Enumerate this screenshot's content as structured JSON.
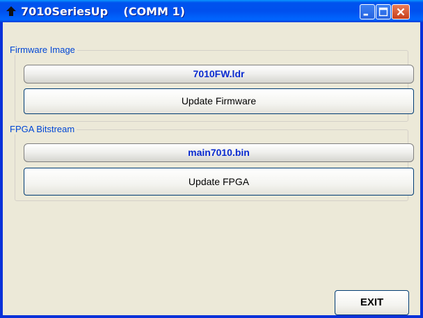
{
  "window": {
    "title": "7010SeriesUp",
    "port": "(COMM 1)",
    "colors": {
      "titlebar": "#0053ee",
      "frame": "#0831d9",
      "face": "#ece9d8",
      "filename": "#0a2bd0",
      "group_label": "#0046d5"
    }
  },
  "firmware": {
    "group_label": "Firmware Image",
    "file_name": "7010FW.ldr",
    "button_label": "Update Firmware"
  },
  "fpga": {
    "group_label": "FPGA Bitstream",
    "file_name": "main7010.bin",
    "button_label": "Update FPGA"
  },
  "exit_label": "EXIT",
  "icons": {
    "app": "arrow-up-icon",
    "minimize": "minimize-icon",
    "maximize": "maximize-icon",
    "close": "close-icon"
  }
}
